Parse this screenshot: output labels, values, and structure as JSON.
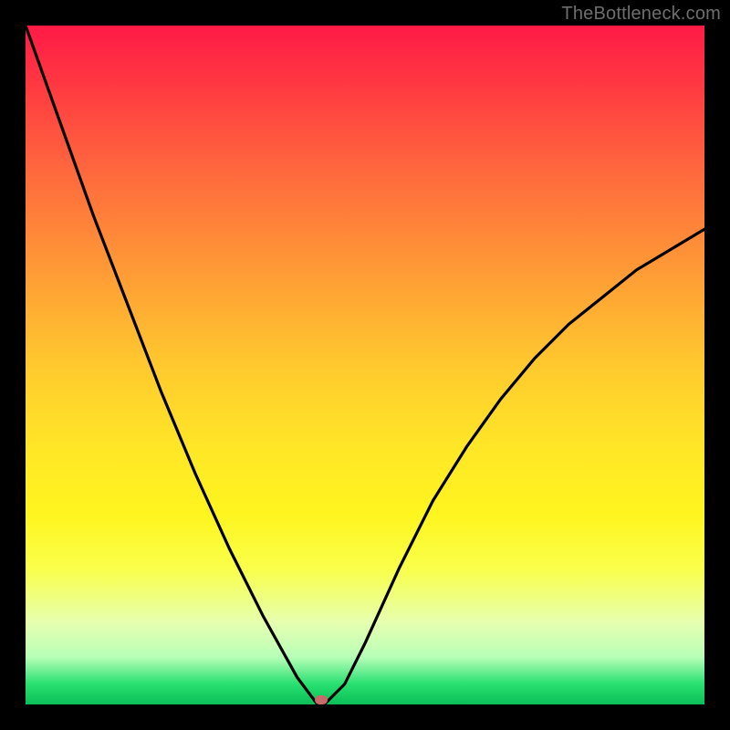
{
  "watermark": "TheBottleneck.com",
  "chart_data": {
    "type": "line",
    "title": "",
    "xlabel": "",
    "ylabel": "",
    "xlim": [
      0,
      1
    ],
    "ylim": [
      0,
      1
    ],
    "background_gradient": {
      "direction": "vertical",
      "stops": [
        {
          "pos": 0.0,
          "color": "#ff1a46"
        },
        {
          "pos": 0.5,
          "color": "#ffc92e"
        },
        {
          "pos": 0.8,
          "color": "#f9ff4a"
        },
        {
          "pos": 1.0,
          "color": "#0bbf58"
        }
      ]
    },
    "series": [
      {
        "name": "curve",
        "color": "#000000",
        "x": [
          0.0,
          0.05,
          0.1,
          0.15,
          0.2,
          0.25,
          0.3,
          0.35,
          0.4,
          0.43,
          0.44,
          0.47,
          0.5,
          0.55,
          0.6,
          0.65,
          0.7,
          0.75,
          0.8,
          0.85,
          0.9,
          0.95,
          1.0
        ],
        "y": [
          1.0,
          0.86,
          0.72,
          0.59,
          0.46,
          0.34,
          0.23,
          0.13,
          0.04,
          0.0,
          0.0,
          0.03,
          0.09,
          0.2,
          0.3,
          0.38,
          0.45,
          0.51,
          0.56,
          0.6,
          0.64,
          0.67,
          0.7
        ]
      }
    ],
    "marker": {
      "name": "min-point",
      "x": 0.435,
      "y": 0.0,
      "color": "#c76a6a"
    }
  }
}
